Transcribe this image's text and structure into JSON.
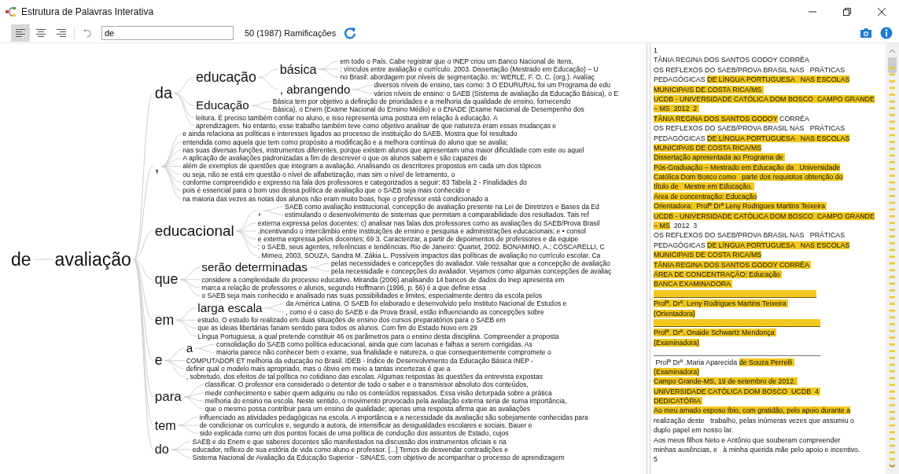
{
  "window": {
    "title": "Estrutura de Palavras Interativa"
  },
  "toolbar": {
    "align_buttons": [
      {
        "kind": "left",
        "selected": true
      },
      {
        "kind": "center",
        "selected": false
      },
      {
        "kind": "right",
        "selected": false
      }
    ],
    "search": {
      "value": "de"
    },
    "branch_count": "50 (1987) Ramificações"
  },
  "word_tree": {
    "text": "de",
    "children": [
      {
        "text": "avaliação",
        "children": [
          {
            "text": "da",
            "children": [
              {
                "text": "educação",
                "children": [
                  {
                    "text": "básica",
                    "children": [
                      {
                        "text": "em todo o País. Cabe registrar que o INEP criou um Banco Nacional de Itens,"
                      },
                      {
                        "text": ": vínculos entre avaliação e currículo. 2003. Dissertação (Mestrado em Educação) – U"
                      },
                      {
                        "text": "no Brasil: abordagem por níveis de segmentação. In: WERLE, F. O. C. (org.). Avaliaç"
                      }
                    ]
                  },
                  {
                    "text": ", abrangendo",
                    "children": [
                      {
                        "text": "diversos níveis de ensino, tais como: 3 O EDURURAL foi um Programa de edu"
                      },
                      {
                        "text": "vários níveis de ensino: o SAEB (Sistema de avaliação da Educação Básica), o E"
                      }
                    ]
                  }
                ]
              },
              {
                "text": "Educação",
                "children": [
                  {
                    "text": "Básica tem por objetivo a definição de prioridades e a melhoria da qualidade de ensino, fornecendo"
                  },
                  {
                    "text": "Básica), o Enem (Exame Nacional do Ensino Médio) e o ENADE (Exame Nacional de Desempenho dos"
                  }
                ]
              },
              {
                "text": "leitura. É preciso também confiar no aluno, e isso representa uma postura em relação à educação. A"
              },
              {
                "text": "aprendizagem. No entanto, esse trabalho também teve como objetivo analisar de que natureza eram essas mudanças e"
              }
            ]
          },
          {
            "text": ",",
            "children": [
              {
                "text": "e ainda relaciona as políticas e interesses ligados ao processo de instituição do SAEB. Mostra que foi resultado"
              },
              {
                "text": "entendida como aquela que tem como propósito a modificação e a melhora contínua do aluno que se avalia;"
              },
              {
                "text": "nas suas diversas funções, instrumentos diferentes, porque existem alunos que apresentam uma maior dificuldade com este ou aquel"
              },
              {
                "text": "A aplicação de avaliações padronizadas a fim de descrever o que os alunos sabem e são capazes de"
              },
              {
                "text": "além de exemplos de questões que integram a avaliação. Analisando os descritores propostos em cada um dos tópicos"
              },
              {
                "text": "ou seja, não se está em questão o nível de alfabetização, mas sim o nível de letramento, o"
              },
              {
                "text": "conforme compreendido e expresso na fala dos professores e categorizados a seguir: 83 Tabela 2 - Finalidades do"
              },
              {
                "text": "pois é essencial para o bom uso dessa política de avaliação que o SAEB seja mais conhecido e"
              },
              {
                "text": "na maioria das vezes as notas dos alunos não eram muito boas, hoje o professor está condicionado a"
              }
            ]
          },
          {
            "text": "educacional",
            "children": [
              {
                "text": ",",
                "children": [
                  {
                    "text": "SAEB como avaliação institucional, concepção de avaliação presente na Lei de Diretrizes e Bases da Ed"
                  },
                  {
                    "text": "estimulando o desenvolvimento de sistemas que permitam a comparabilidade dos resultados. Tais ref"
                  }
                ]
              },
              {
                "text": "externa expressa pelos docentes; c) analisar nas falas dos professores como as avaliações do SAEB/Prova Brasil"
              },
              {
                "text": ",incentivando o intercâmbio entre instituições de ensino e pesquisa e administrações educacionais; e • consol"
              },
              {
                "text": "e externa expressa pelos docentes; 69 3. Caracterizar, a partir de depoimentos de professores e da equipe"
              },
              {
                "text": ": o SAEB, seus agentes, referências e tendências. Rio de Janeiro: Quartet, 2002. BONAMINO, A.; COSCARELLI, C"
              },
              {
                "text": ". Mimeo, 2003. SOUZA, Sandra M. Zákia L. Possíveis impactos das políticas de avaliação no currículo escolar. Ca"
              }
            ]
          },
          {
            "text": "que",
            "children": [
              {
                "text": "serão determinadas",
                "children": [
                  {
                    "text": "pelas necessidades e concepções do avaliador. Vale ressaltar que a concepção de avaliação"
                  },
                  {
                    "text": "pela necessidade e concepções do avaliador. Vejamos como algumas concepções de avaliaç"
                  }
                ]
              },
              {
                "text": "considere a complexidade do processo educativo. Miranda (2006) analisando 14 bancos de dados do Inep apresenta em"
              },
              {
                "text": "marca a relação de professores e alunos, segundo Hoffmann (1996, p. 56) é a que define essa"
              },
              {
                "text": "o SAEB seja mais conhecido e analisado nas suas possibilidades e limites, especialmente dentro da escola pelos"
              }
            ]
          },
          {
            "text": "em",
            "children": [
              {
                "text": "larga escala",
                "children": [
                  {
                    "text": "da América Latina. O SAEB foi elaborado e desenvolvido pelo Instituto Nacional de Estudos e"
                  },
                  {
                    "text": ", como é o caso do SAEB e da Prova Brasil, estão influenciando as concepções sobre"
                  }
                ]
              },
              {
                "text": "estudo. O estudo foi realizado em duas situações de ensino dos cursos preparatórios para o SAEB em"
              },
              {
                "text": "que as ideias libertárias fariam sentido para todos os alunos. Com fim do Estado Novo em 29"
              },
              {
                "text": "Língua Portuguesa, a qual pretende constituir 46 os parâmetros para o ensino desta disciplina. Compreender a proposta"
              }
            ]
          },
          {
            "text": "e",
            "children": [
              {
                "text": "a",
                "children": [
                  {
                    "text": "consolidação do SAEB como política educacional, ainda que com lacunas e falhas a serem corrigidas. As"
                  },
                  {
                    "text": "maioria parece não conhecer bem o exame, sua finalidade e natureza, o que consequentemente compromete o"
                  }
                ]
              },
              {
                "text": "COMPUTADOR ET melhoria da educação no Brasil. IDEB - Índice de Desenvolvimento da Educação Básica INEP -"
              },
              {
                "text": "definir qual o modelo mais apropriado, mas o óbvio em meio a tantas incertezas é que a"
              },
              {
                "text": ", sobretudo, dos efeitos de tal política no cotidiano das escolas. Algumas respostas às questões da entrevista expostas"
              }
            ]
          },
          {
            "text": "para",
            "children": [
              {
                "text": "classificar. O professor era considerado o detentor de todo o saber e o transmissor absoluto dos conteúdos,"
              },
              {
                "text": "medir conhecimento e saber quem adquiriu ou não os conteúdos repassados. Essa visão deturpada sobre a prática"
              },
              {
                "text": "melhoria do ensino na escola. Neste sentido, o movimento provocado pela avaliação externa seria de suma importância,"
              },
              {
                "text": "que o mesmo possa contribuir para um ensino de qualidade; apenas uma resposta afirma que as avaliações"
              }
            ]
          },
          {
            "text": "tem",
            "children": [
              {
                "text": "influenciado as atividades pedagógicas na escola. A importância e a necessidade da avaliação são sobejamente conhecidas para"
              },
              {
                "text": "de condicionar os currículos e, segundo a autora, de intensificar as desigualdades escolares e sociais. Bauer e"
              },
              {
                "text": "sido explicada como um dos pontos focais de uma política de condução dos assuntos de Estado, cujos"
              }
            ]
          },
          {
            "text": "do",
            "children": [
              {
                "text": "SAEB e do Enem e que saberes docentes são manifestados na discussão dos instrumentos oficiais e na"
              },
              {
                "text": "educador, reflexo de sua estória de vida como aluno e professor. [...] Temos de desvendar contradições e"
              },
              {
                "text": "Sistema Nacional de Avaliação da Educação Superior - SINAES, com objetivo de acompanhar o processo de aprendizagem"
              }
            ]
          }
        ]
      }
    ]
  },
  "document": {
    "lines": [
      [
        {
          "text": "1",
          "highlighted": false
        }
      ],
      [
        {
          "text": "TÂNIA REGINA DOS SANTOS GODOY CORRÊA",
          "highlighted": false
        }
      ],
      [
        {
          "text": "OS REFLEXOS DO SAEB/PROVA BRASIL NAS   PRÁTICAS",
          "highlighted": false
        }
      ],
      [
        {
          "text": "PEDAGÓGICAS ",
          "highlighted": false
        },
        {
          "text": "DE LÍNGUA PORTUGUESA   NAS ESCOLAS",
          "highlighted": true
        }
      ],
      [
        {
          "text": "MUNICIPAIS DE COSTA RICA/MS ",
          "highlighted": true
        }
      ],
      [
        {
          "text": "UCDB - UNIVERSIDADE CATÓLICA DOM BOSCO  CAMPO GRANDE",
          "highlighted": true
        }
      ],
      [
        {
          "text": "– MS  2012  2 ",
          "highlighted": true
        }
      ],
      [
        {
          "text": "TÂNIA REGINA DOS SANTOS GODOY",
          "highlighted": true
        },
        {
          "text": " CORRÊA",
          "highlighted": false
        }
      ],
      [
        {
          "text": "OS REFLEXOS DO SAEB/PROVA BRASIL NAS   PRÁTICAS",
          "highlighted": false
        }
      ],
      [
        {
          "text": "PEDAGÓGICAS ",
          "highlighted": false
        },
        {
          "text": "DE LÍNGUA PORTUGUESA   NAS ESCOLAS",
          "highlighted": true
        }
      ],
      [
        {
          "text": "MUNICIPAIS DE COSTA RICA/MS",
          "highlighted": true
        }
      ],
      [
        {
          "text": "Dissertação apresentada ao Programa de ",
          "highlighted": true
        }
      ],
      [
        {
          "text": "Pós-Graduação – Mestrado em Educação da   Universidade",
          "highlighted": true
        }
      ],
      [
        {
          "text": "Católica Dom Bosco como   parte dos requisitos obtenção do",
          "highlighted": true
        }
      ],
      [
        {
          "text": "título de   Mestre em Educação. ",
          "highlighted": true
        }
      ],
      [
        {
          "text": "Área de concentração: Educação",
          "highlighted": true
        }
      ],
      [
        {
          "text": "Orientadora:  Profª Drª Leny Rodrigues Martins Teixeira ",
          "highlighted": true
        }
      ],
      [
        {
          "text": "UCDB - UNIVERSIDADE CATÓLICA DOM BOSCO  CAMPO GRANDE",
          "highlighted": true
        }
      ],
      [
        {
          "text": "– MS",
          "highlighted": true
        },
        {
          "text": "  2012  3",
          "highlighted": false
        }
      ],
      [
        {
          "text": "OS REFLEXOS DO SAEB/PROVA BRASIL NAS   PRÁTICAS",
          "highlighted": false
        }
      ],
      [
        {
          "text": "PEDAGÓGICAS ",
          "highlighted": false
        },
        {
          "text": "DE LÍNGUA PORTUGUESA   NAS ESCOLAS",
          "highlighted": true
        }
      ],
      [
        {
          "text": "MUNICIPAIS DE COSTA RICA/MS",
          "highlighted": true
        }
      ],
      [
        {
          "text": "TÂNIA REGINA DOS SANTOS GODOY CORRÊA ",
          "highlighted": true
        }
      ],
      [
        {
          "text": "ÁREA DE CONCENTRAÇÃO: Educação ",
          "highlighted": true
        }
      ],
      [
        {
          "text": "BANCA EXAMINADORA ",
          "highlighted": true
        }
      ],
      [
        {
          "text": "__________________________________________",
          "highlighted": true
        }
      ],
      [
        {
          "text": "Profª. Drª. Leny Rodrigues Martins Teixeira ",
          "highlighted": true
        }
      ],
      [
        {
          "text": "(Orientadora)",
          "highlighted": true
        }
      ],
      [
        {
          "text": "___________________________________________",
          "highlighted": true
        }
      ],
      [
        {
          "text": "Profª. Drª. Onaide Schwartz Mendonça ",
          "highlighted": true
        }
      ],
      [
        {
          "text": "(Examinadora)",
          "highlighted": true
        }
      ],
      [
        {
          "text": "___________________________________________",
          "highlighted": false
        }
      ],
      [
        {
          "text": " Profª Drª .Maria Aparecida ",
          "highlighted": false
        },
        {
          "text": "de Souza Perrelli ",
          "highlighted": true
        }
      ],
      [
        {
          "text": "(Examinadora)",
          "highlighted": true
        }
      ],
      [
        {
          "text": "Campo Grande-MS, 19 de setembro de 2012. ",
          "highlighted": true
        }
      ],
      [
        {
          "text": "UNIVERSIDADE CATÓLICA DOM BOSCO  UCDB  4 ",
          "highlighted": true
        }
      ],
      [
        {
          "text": "DEDICATÓRIA ",
          "highlighted": true
        }
      ],
      [
        {
          "text": "Ao meu amado esposo Íbio, com gratidão, pelo apoio durante a",
          "highlighted": true
        }
      ],
      [
        {
          "text": "realização deste   trabalho, pelas inúmeras vezes que assumiu o",
          "highlighted": false
        }
      ],
      [
        {
          "text": "duplo papel em nosso lar.",
          "highlighted": false
        }
      ],
      [
        {
          "text": "Aos meus filhos Neto e Antônio que souberam compreender",
          "highlighted": false
        }
      ],
      [
        {
          "text": "minhas ausências, e   à minha querida mãe pelo apoio e incentivo.",
          "highlighted": false
        }
      ],
      [
        {
          "text": "5",
          "highlighted": false
        }
      ]
    ]
  }
}
